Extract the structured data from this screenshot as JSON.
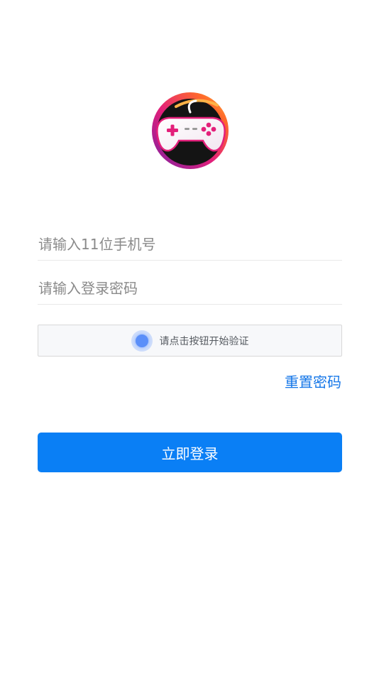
{
  "app": {
    "logo_icon": "gamepad-logo-icon"
  },
  "login": {
    "phone_placeholder": "请输入11位手机号",
    "password_placeholder": "请输入登录密码",
    "captcha_text": "请点击按钮开始验证",
    "reset_password": "重置密码",
    "submit": "立即登录"
  },
  "colors": {
    "accent": "#0a7ff5",
    "link": "#1677e8",
    "captcha_dot": "#5b8ff9"
  }
}
